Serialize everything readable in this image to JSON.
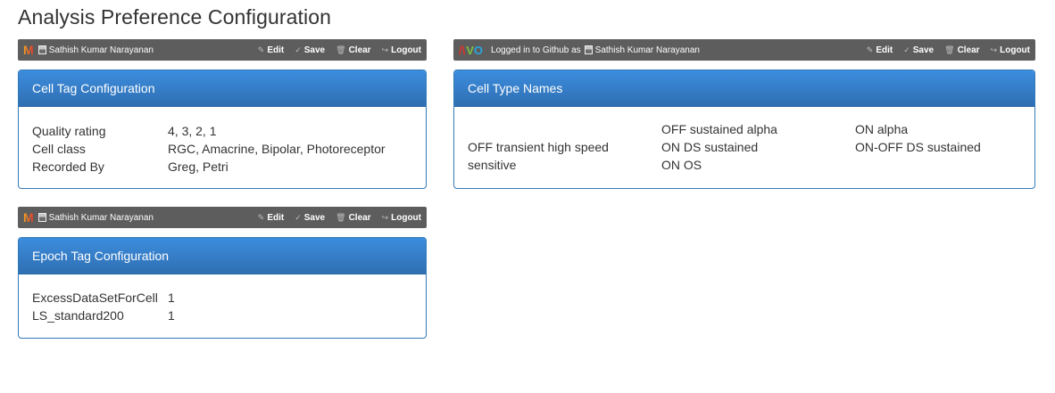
{
  "page": {
    "title": "Analysis Preference Configuration"
  },
  "toolbars": {
    "cell_tag": {
      "logo": "M",
      "user_name": "Sathish Kumar Narayanan",
      "actions": [
        "Edit",
        "Save",
        "Clear",
        "Logout"
      ]
    },
    "cell_type": {
      "logo": [
        "A",
        "V",
        "O"
      ],
      "status": "Logged in to Github as",
      "user_name": "Sathish Kumar Narayanan",
      "actions": [
        "Edit",
        "Save",
        "Clear",
        "Logout"
      ]
    },
    "epoch_tag": {
      "logo": "M",
      "user_name": "Sathish Kumar Narayanan",
      "actions": [
        "Edit",
        "Save",
        "Clear",
        "Logout"
      ]
    }
  },
  "icons": {
    "edit": "pencil-icon",
    "save": "check-icon",
    "clear": "trash-icon",
    "logout": "logout-icon"
  },
  "colors": {
    "toolbar_bg": "#5d5d5d",
    "panel_heading": "#337ab7",
    "logo_red": "#e0322c",
    "logo_orange": "#f5a623",
    "logo_green": "#7ac143",
    "logo_blue": "#29a8e0"
  },
  "cell_tag_panel": {
    "title": "Cell Tag Configuration",
    "rows": [
      {
        "key": "Quality rating",
        "value": "4, 3, 2, 1"
      },
      {
        "key": "Cell class",
        "value": "RGC, Amacrine, Bipolar, Photoreceptor"
      },
      {
        "key": "Recorded By",
        "value": "Greg, Petri"
      }
    ]
  },
  "cell_type_panel": {
    "title": "Cell Type Names",
    "names": {
      "off_sustained_alpha": "OFF sustained alpha",
      "on_alpha": "ON alpha",
      "off_transient": "OFF transient high speed",
      "on_ds_sustained": "ON DS sustained",
      "on_off_ds_sustained": "ON-OFF DS sustained",
      "sensitive": "sensitive",
      "on_os": "ON OS"
    }
  },
  "epoch_tag_panel": {
    "title": "Epoch Tag Configuration",
    "rows": [
      {
        "key": "ExcessDataSetForCell",
        "value": "1"
      },
      {
        "key": "LS_standard200",
        "value": "1"
      }
    ]
  }
}
